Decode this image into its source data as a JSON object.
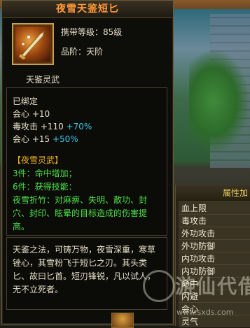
{
  "tooltip": {
    "title": "夜雪天鉴短匕",
    "carry_level": "携带等级：85级",
    "grade": "品阶：天阶",
    "subtitle": "天鉴灵武",
    "attrs": [
      {
        "text": "已绑定",
        "color": "white"
      },
      {
        "text": "会心 +10",
        "color": "white"
      },
      {
        "text": "毒攻击 +110",
        "color": "white",
        "extra": "+70%"
      },
      {
        "text": "会心 +15",
        "color": "white",
        "extra": "+50%"
      }
    ],
    "set_name": "【夜雪灵武】",
    "set_bonus_3": "3件：命中增加；",
    "set_bonus_6": "6件：获得技能：",
    "set_effect": "夜雪折竹：对麻痹、失明、散功、封穴、封印、眩晕的目标造成的伤害提高。",
    "lore": "天鉴之法，可铸万物，夜雪深重，寒草锉心，其雪粉飞于短匕之刃。其头类匕、故曰匕首。短刃锋锐，凡以试人，无不立死者。"
  },
  "attribute_panel": {
    "title": "属性加",
    "rows": [
      "血上限",
      "毒攻击",
      "外功攻击",
      "外功防御",
      "内功攻击",
      "内功防御",
      "命中",
      "闪避",
      "会心",
      "灵气"
    ]
  },
  "watermark": {
    "text": "游仙代借",
    "url": "www.sxds.com"
  },
  "colors": {
    "title": "#ff9a3a",
    "set_text": "#4fe04a",
    "bonus_percent": "#3ac8e8",
    "set_name": "#e8b020"
  }
}
